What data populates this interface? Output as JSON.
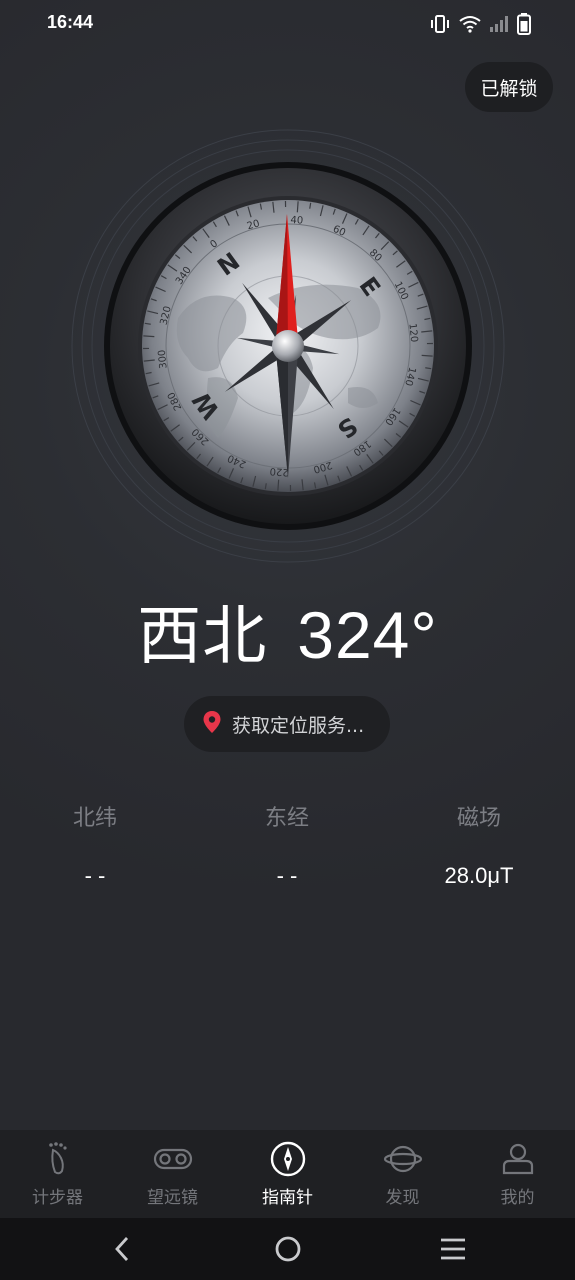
{
  "status_bar": {
    "time": "16:44",
    "icons": [
      "vibrate-icon",
      "wifi-icon",
      "signal-icon",
      "battery-icon"
    ]
  },
  "unlock_label": "已解锁",
  "compass": {
    "cardinals": [
      "N",
      "E",
      "S",
      "W"
    ],
    "degree_labels": [
      "0",
      "20",
      "40",
      "60",
      "80",
      "100",
      "120",
      "140",
      "160",
      "180",
      "200",
      "220",
      "240",
      "260",
      "280",
      "300",
      "320",
      "340"
    ],
    "needle_color": "#e0201e"
  },
  "heading": {
    "direction": "西北",
    "degrees": "324°"
  },
  "location": {
    "icon": "location-pin-icon",
    "text": "获取定位服务...",
    "icon_color": "#e8364a"
  },
  "info": [
    {
      "label": "北纬",
      "value": "- -"
    },
    {
      "label": "东经",
      "value": "- -"
    },
    {
      "label": "磁场",
      "value": "28.0μT"
    }
  ],
  "nav": {
    "items": [
      {
        "label": "计步器",
        "icon": "footprint-icon"
      },
      {
        "label": "望远镜",
        "icon": "binoculars-icon"
      },
      {
        "label": "指南针",
        "icon": "compass-icon"
      },
      {
        "label": "发现",
        "icon": "planet-icon"
      },
      {
        "label": "我的",
        "icon": "profile-icon"
      }
    ],
    "active_index": 2
  },
  "system_nav": [
    "back-icon",
    "home-icon",
    "menu-icon"
  ]
}
